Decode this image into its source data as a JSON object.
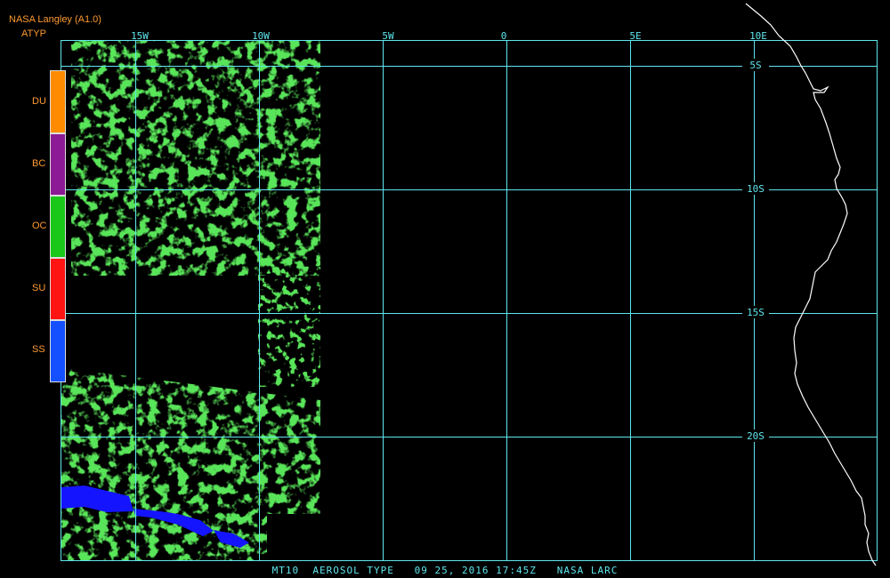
{
  "header": {
    "source": "NASA Langley (A1.0)",
    "product": "ATYP"
  },
  "legend": {
    "items": [
      {
        "code": "DU",
        "color": "#ff8c00"
      },
      {
        "code": "BC",
        "color": "#8c1a96"
      },
      {
        "code": "OC",
        "color": "#19c819"
      },
      {
        "code": "SU",
        "color": "#ff1414"
      },
      {
        "code": "SS",
        "color": "#1450ff"
      }
    ]
  },
  "map": {
    "longitude_labels": [
      "15W",
      "10W",
      "5W",
      "0",
      "5E",
      "10E"
    ],
    "latitude_labels": [
      "5S",
      "10S",
      "15S",
      "20S"
    ],
    "grid_color": "#5fe6ee",
    "coastline_color": "#ffffff",
    "data_colors": {
      "OC": "#19c819",
      "SS": "#1414ff"
    }
  },
  "caption": "MT10  AEROSOL TYPE   09 25, 2016 17:45Z   NASA LARC"
}
